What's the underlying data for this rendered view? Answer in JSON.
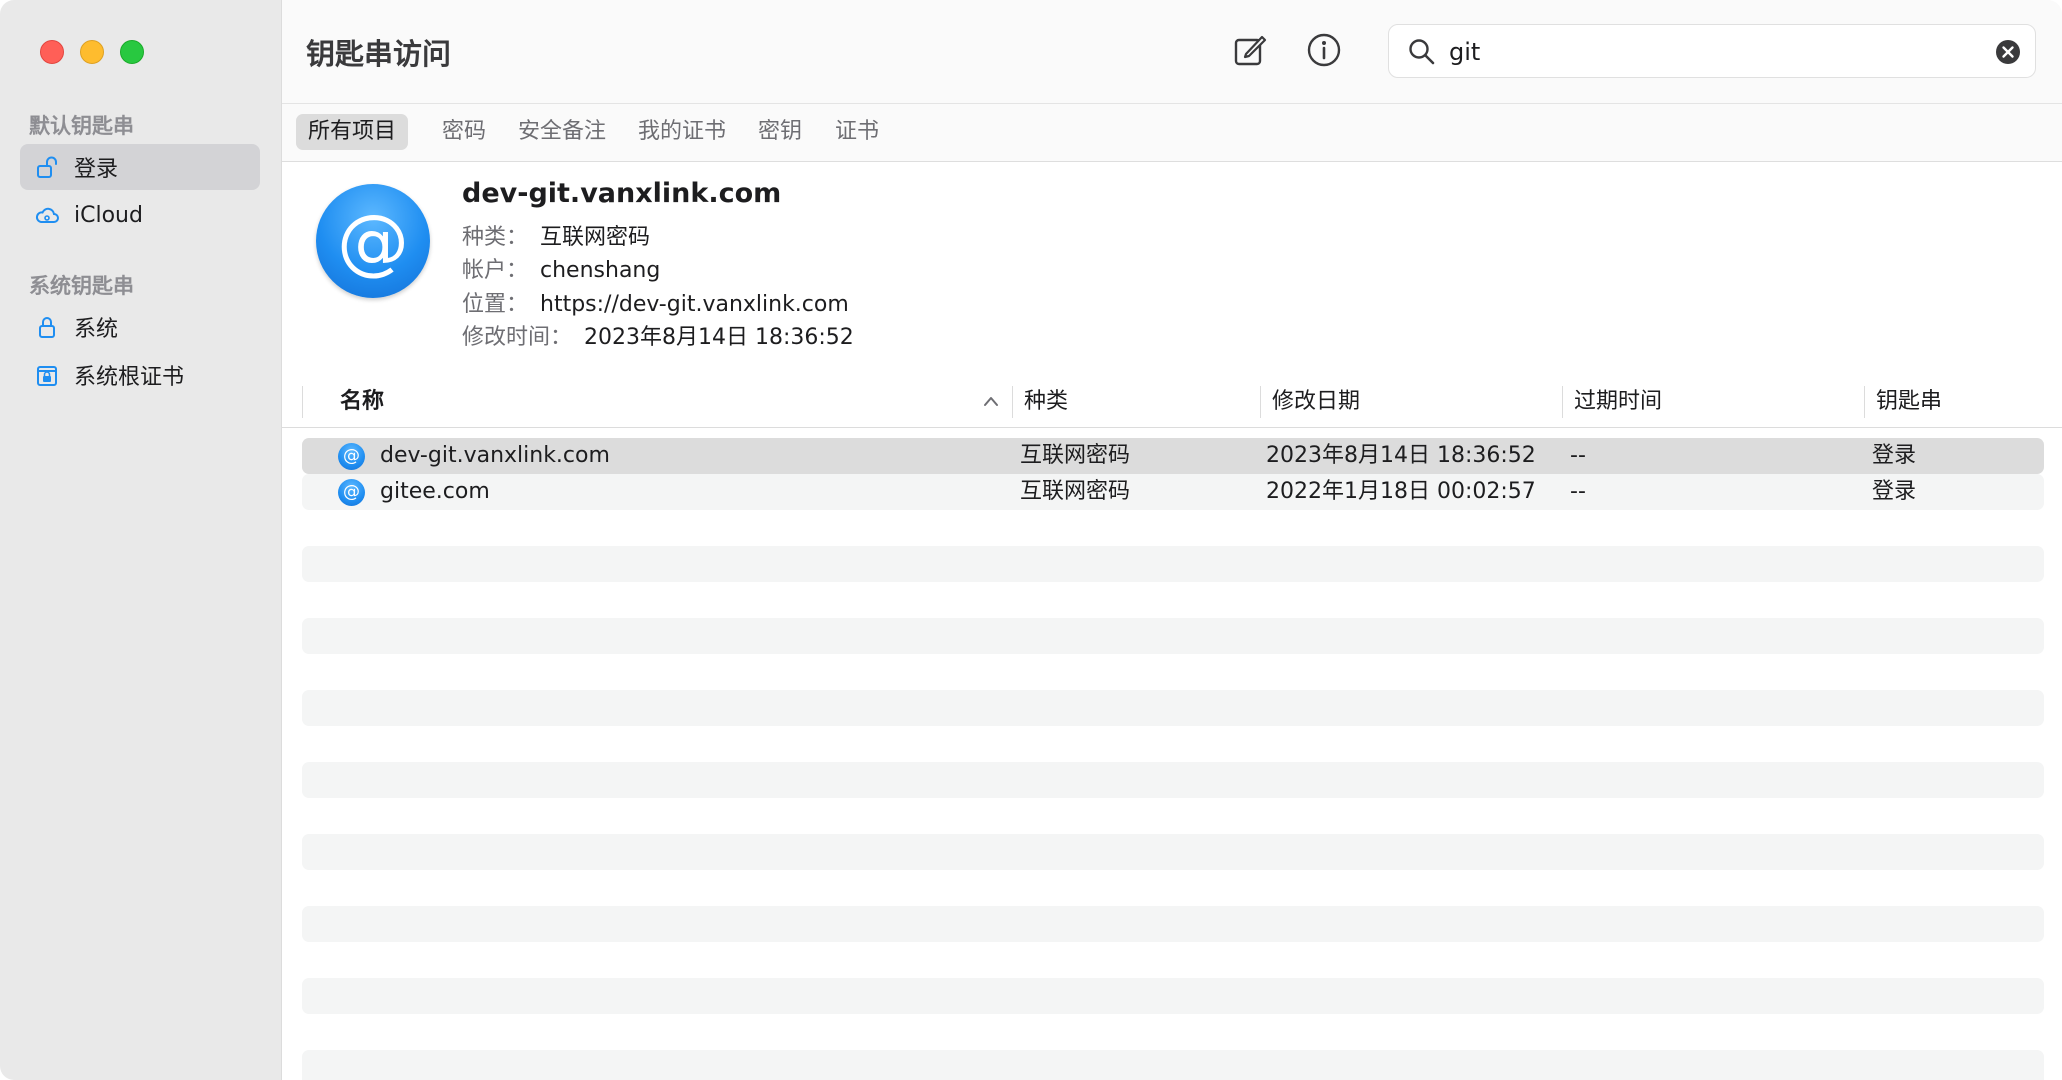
{
  "app": {
    "title": "钥匙串访问"
  },
  "sidebar": {
    "sections": [
      {
        "title": "默认钥匙串",
        "items": [
          {
            "label": "登录",
            "icon": "lock-open-icon",
            "selected": true
          },
          {
            "label": "iCloud",
            "icon": "icloud-icon",
            "selected": false
          }
        ]
      },
      {
        "title": "系统钥匙串",
        "items": [
          {
            "label": "系统",
            "icon": "lock-icon",
            "selected": false
          },
          {
            "label": "系统根证书",
            "icon": "cert-cabinet-icon",
            "selected": false
          }
        ]
      }
    ]
  },
  "toolbar": {
    "compose_icon": "compose-icon",
    "info_icon": "info-icon",
    "search": {
      "value": "git",
      "icon": "search-icon",
      "clear_icon": "clear-icon"
    }
  },
  "tabs": [
    {
      "label": "所有项目",
      "active": true
    },
    {
      "label": "密码",
      "active": false
    },
    {
      "label": "安全备注",
      "active": false
    },
    {
      "label": "我的证书",
      "active": false
    },
    {
      "label": "密钥",
      "active": false
    },
    {
      "label": "证书",
      "active": false
    }
  ],
  "detail": {
    "icon_glyph": "@",
    "title": "dev-git.vanxlink.com",
    "kind_label": "种类：",
    "kind_value": "互联网密码",
    "account_label": "帐户：",
    "account_value": "chenshang",
    "location_label": "位置：",
    "location_value": "https://dev-git.vanxlink.com",
    "modified_label": "修改时间：",
    "modified_value": "2023年8月14日 18:36:52"
  },
  "table": {
    "columns": {
      "name": "名称",
      "kind": "种类",
      "modified": "修改日期",
      "expires": "过期时间",
      "keychain": "钥匙串"
    },
    "sort_icon": "chevron-up-icon",
    "rows": [
      {
        "icon_glyph": "@",
        "name": "dev-git.vanxlink.com",
        "kind": "互联网密码",
        "modified": "2023年8月14日 18:36:52",
        "expires": "--",
        "keychain": "登录",
        "selected": true
      },
      {
        "icon_glyph": "@",
        "name": "gitee.com",
        "kind": "互联网密码",
        "modified": "2022年1月18日 00:02:57",
        "expires": "--",
        "keychain": "登录",
        "selected": false
      }
    ]
  },
  "colors": {
    "accent": "#1f8ef1",
    "sidebar_bg": "#e9e9e9",
    "selection": "#dcdcdc"
  }
}
